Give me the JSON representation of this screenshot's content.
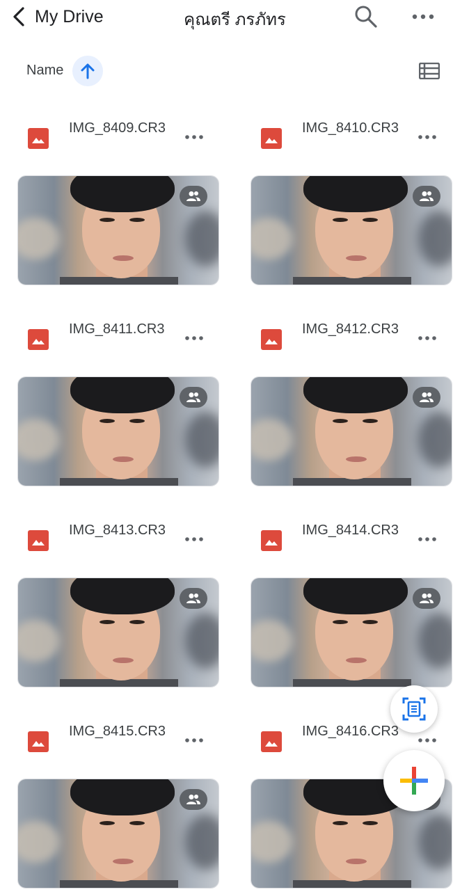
{
  "header": {
    "back_label": "My Drive",
    "title": "คุณตรี ภรภัทร",
    "icons": {
      "back": "chevron-left-icon",
      "search": "search-icon",
      "more": "more-horizontal-icon"
    }
  },
  "sort": {
    "label": "Name",
    "direction_icon": "arrow-up-icon",
    "view_toggle_icon": "list-view-icon"
  },
  "files": [
    {
      "name": "IMG_8409.CR3",
      "type_icon": "image-file-icon",
      "shared": true
    },
    {
      "name": "IMG_8410.CR3",
      "type_icon": "image-file-icon",
      "shared": true
    },
    {
      "name": "IMG_8411.CR3",
      "type_icon": "image-file-icon",
      "shared": true
    },
    {
      "name": "IMG_8412.CR3",
      "type_icon": "image-file-icon",
      "shared": true
    },
    {
      "name": "IMG_8413.CR3",
      "type_icon": "image-file-icon",
      "shared": true
    },
    {
      "name": "IMG_8414.CR3",
      "type_icon": "image-file-icon",
      "shared": true
    },
    {
      "name": "IMG_8415.CR3",
      "type_icon": "image-file-icon",
      "shared": true
    },
    {
      "name": "IMG_8416.CR3",
      "type_icon": "image-file-icon",
      "shared": true
    }
  ],
  "fab": {
    "scan_icon": "document-scan-icon",
    "new_icon": "plus-multicolor-icon"
  },
  "colors": {
    "accent": "#1a73e8",
    "sort_chip_bg": "#e8f0fe",
    "image_file_red": "#dd4a3c",
    "shared_badge": "#5f6368",
    "plus_red": "#ea4335",
    "plus_blue": "#4285f4",
    "plus_yellow": "#fbbc04",
    "plus_green": "#34a853"
  }
}
